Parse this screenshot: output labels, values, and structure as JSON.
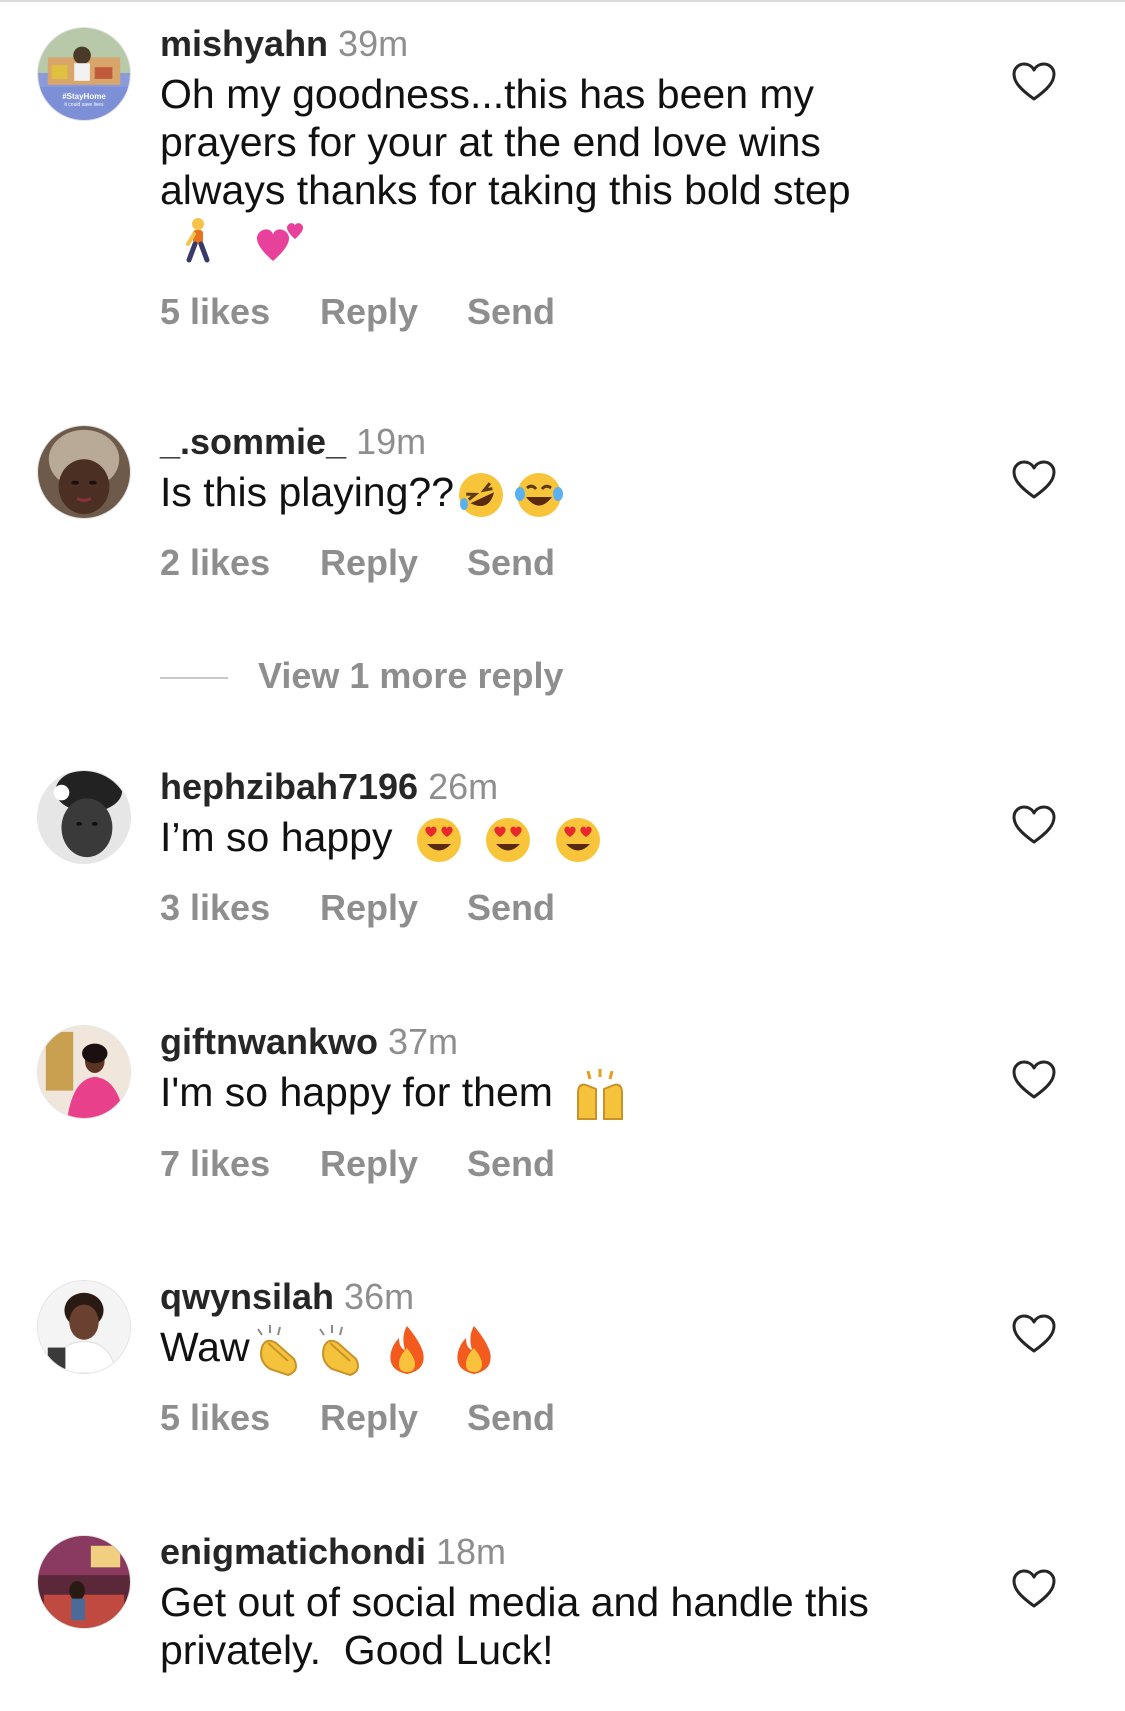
{
  "comments": [
    {
      "username": "mishyahn",
      "time": "39m",
      "text": "Oh my goodness...this has been my prayers for your at the end love wins always thanks for taking this bold step",
      "emojis": [
        "person-walking",
        "two-hearts"
      ],
      "likes": "5 likes",
      "reply": "Reply",
      "send": "Send",
      "avatar_badge": "#StayHome",
      "avatar_sub": "it could save lives"
    },
    {
      "username": "_.sommie_",
      "time": "19m",
      "text": "Is this playing??",
      "emojis": [
        "rofl",
        "tears-of-joy"
      ],
      "likes": "2 likes",
      "reply": "Reply",
      "send": "Send"
    },
    {
      "username": "hephzibah7196",
      "time": "26m",
      "text": "I’m so happy",
      "emojis": [
        "heart-eyes",
        "heart-eyes",
        "heart-eyes"
      ],
      "likes": "3 likes",
      "reply": "Reply",
      "send": "Send"
    },
    {
      "username": "giftnwankwo",
      "time": "37m",
      "text": "I'm so happy for them",
      "emojis": [
        "raising-hands"
      ],
      "likes": "7 likes",
      "reply": "Reply",
      "send": "Send"
    },
    {
      "username": "qwynsilah",
      "time": "36m",
      "text": "Waw",
      "emojis": [
        "clapping",
        "clapping",
        "fire",
        "fire"
      ],
      "likes": "5 likes",
      "reply": "Reply",
      "send": "Send"
    },
    {
      "username": "enigmatichondi",
      "time": "18m",
      "text": "Get out of social media and handle this privately.  Good Luck!",
      "emojis": []
    }
  ],
  "view_more_replies": "View 1 more reply",
  "colors": {
    "username": "#262626",
    "meta": "#8e8e8e",
    "text": "#111111",
    "divider": "#dbdbdb"
  },
  "icons": {
    "like": "heart-outline-icon"
  }
}
